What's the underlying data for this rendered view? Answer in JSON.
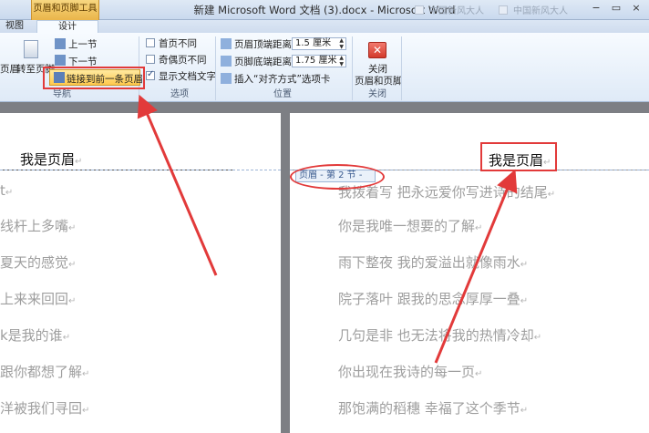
{
  "window": {
    "title": "新建 Microsoft Word 文档 (3).docx - Microsoft Word",
    "context_tool": "页眉和页脚工具",
    "far_tabs": [
      "中国新风大人",
      "中国新风大人"
    ],
    "buttons": [
      "−",
      "▭",
      "×"
    ]
  },
  "tabs": {
    "view": "视图",
    "design": "设计"
  },
  "ribbon": {
    "nav": {
      "page_header": "页眉",
      "goto_footer": "转至页脚",
      "prev_section": "上一节",
      "next_section": "下一节",
      "link_to_previous": "链接到前一条页眉",
      "group_label": "导航"
    },
    "options": {
      "first_page_diff": "首页不同",
      "odd_even_diff": "奇偶页不同",
      "show_doc_text": "显示文档文字",
      "group_label": "选项",
      "show_doc_text_checked": true
    },
    "position": {
      "header_top_label": "页眉顶端距离:",
      "header_top_value": "1.5 厘米",
      "footer_bottom_label": "页脚底端距离:",
      "footer_bottom_value": "1.75 厘米",
      "insert_align_tab": "插入“对齐方式”选项卡",
      "group_label": "位置"
    },
    "close": {
      "label_line1": "关闭",
      "label_line2": "页眉和页脚",
      "group_label": "关闭"
    }
  },
  "document": {
    "left_header": "我是页眉",
    "right_header": "我是页眉",
    "header_tag": "页眉 - 第 2 节 -",
    "left_lines": [
      "t",
      "线杆上多嘴",
      "夏天的感觉",
      "上来来回回",
      "k是我的谁",
      "跟你都想了解",
      "洋被我们寻回"
    ],
    "right_lines": [
      "我拨着写  把永远爱你写进诗的结尾",
      "你是我唯一想要的了解",
      "雨下整夜  我的爱溢出就像雨水",
      "院子落叶  跟我的思念厚厚一叠",
      "几句是非  也无法将我的热情冷却",
      "你出现在我诗的每一页",
      "那饱满的稻穗  幸福了这个季节"
    ]
  },
  "colors": {
    "annotation": "#e23a3a",
    "context_tab": "#eab54a"
  }
}
